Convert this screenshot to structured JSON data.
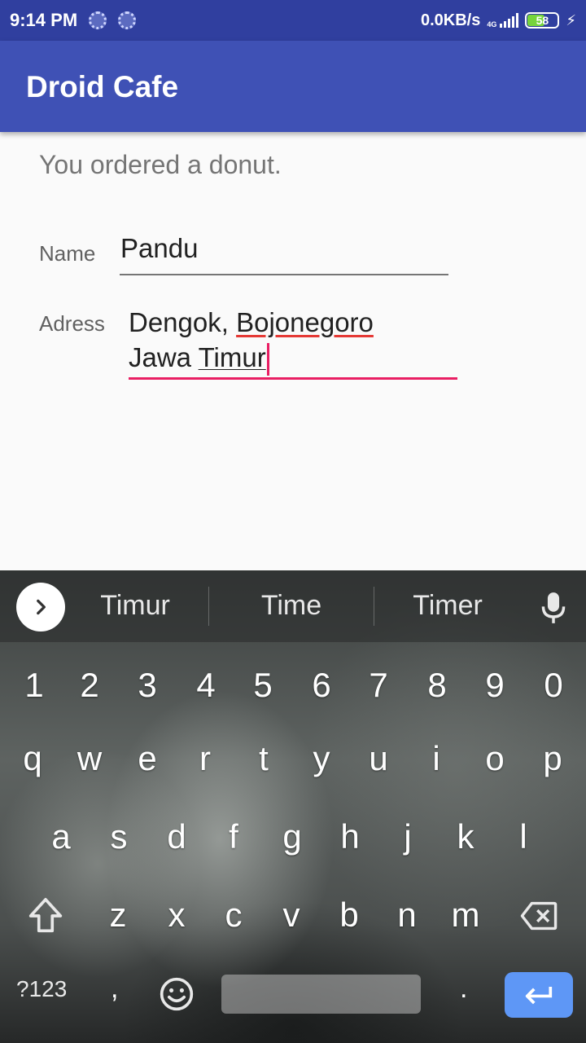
{
  "status_bar": {
    "time": "9:14 PM",
    "net_speed": "0.0KB/s",
    "network_type": "4G",
    "battery_level": "58",
    "icons": [
      "sync-dot-icon",
      "sync-dot-icon",
      "signal-icon",
      "battery-icon",
      "charging-bolt-icon"
    ]
  },
  "app_bar": {
    "title": "Droid Cafe"
  },
  "order": {
    "message": "You ordered a donut."
  },
  "form": {
    "name_label": "Name",
    "name_value": "Pandu",
    "address_label": "Adress",
    "address_line1_plain": "Dengok, ",
    "address_line1_misspelled": "Bojonegoro",
    "address_line2_plain": "Jawa ",
    "address_line2_composing": "Timur"
  },
  "keyboard": {
    "suggestions": [
      "Timur",
      "Time",
      "Timer"
    ],
    "number_row": [
      "1",
      "2",
      "3",
      "4",
      "5",
      "6",
      "7",
      "8",
      "9",
      "0"
    ],
    "row_q": [
      "q",
      "w",
      "e",
      "r",
      "t",
      "y",
      "u",
      "i",
      "o",
      "p"
    ],
    "row_a": [
      "a",
      "s",
      "d",
      "f",
      "g",
      "h",
      "j",
      "k",
      "l"
    ],
    "row_z": [
      "z",
      "x",
      "c",
      "v",
      "b",
      "n",
      "m"
    ],
    "symbols_label": "?123",
    "comma": ",",
    "period": ".",
    "icons": [
      "expand-chevron-icon",
      "microphone-icon",
      "shift-icon",
      "backspace-icon",
      "emoji-icon",
      "enter-icon"
    ],
    "accent_color": "#5e97f6"
  },
  "colors": {
    "primary": "#3f51b5",
    "primary_dark": "#303f9f",
    "accent": "#e91e63"
  }
}
